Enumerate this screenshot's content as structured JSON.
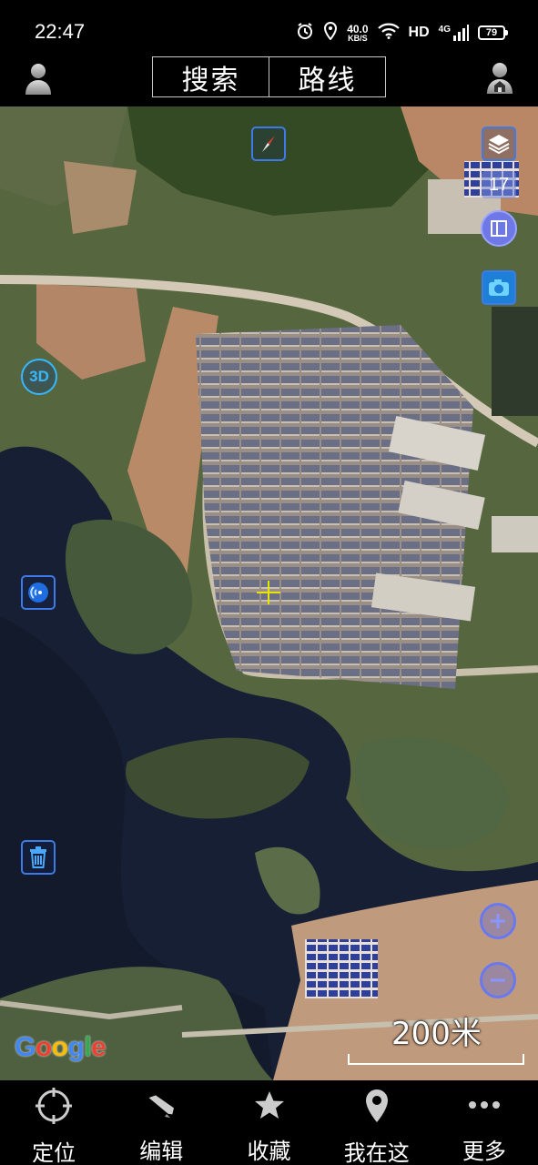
{
  "status_bar": {
    "time": "22:47",
    "net_speed_value": "40.0",
    "net_speed_unit": "KB/S",
    "hd": "HD",
    "network": "4G",
    "battery": "79"
  },
  "header": {
    "left_icon": "user-icon",
    "right_icon": "user-home-icon",
    "tabs": [
      {
        "label": "搜索"
      },
      {
        "label": "路线"
      }
    ]
  },
  "map": {
    "zoom_level": "17",
    "scale_label": "200米",
    "logo": "Google",
    "controls": {
      "compass": "compass-icon",
      "layers": "layers-icon",
      "view_3d": "3D",
      "locate_signal": "signal-icon",
      "trash": "trash-icon",
      "zoom_in": "plus-icon",
      "zoom_out": "minus-icon",
      "camera": "camera-icon",
      "map_mode": "map-mode-icon"
    },
    "colors": {
      "control_border": "#3f7be8",
      "crosshair": "#e6e600"
    }
  },
  "bottom_nav": [
    {
      "label": "定位",
      "icon": "crosshair-icon"
    },
    {
      "label": "编辑",
      "icon": "pencil-icon"
    },
    {
      "label": "收藏",
      "icon": "star-icon"
    },
    {
      "label": "我在这",
      "icon": "location-pin-icon"
    },
    {
      "label": "更多",
      "icon": "more-dots-icon"
    }
  ]
}
